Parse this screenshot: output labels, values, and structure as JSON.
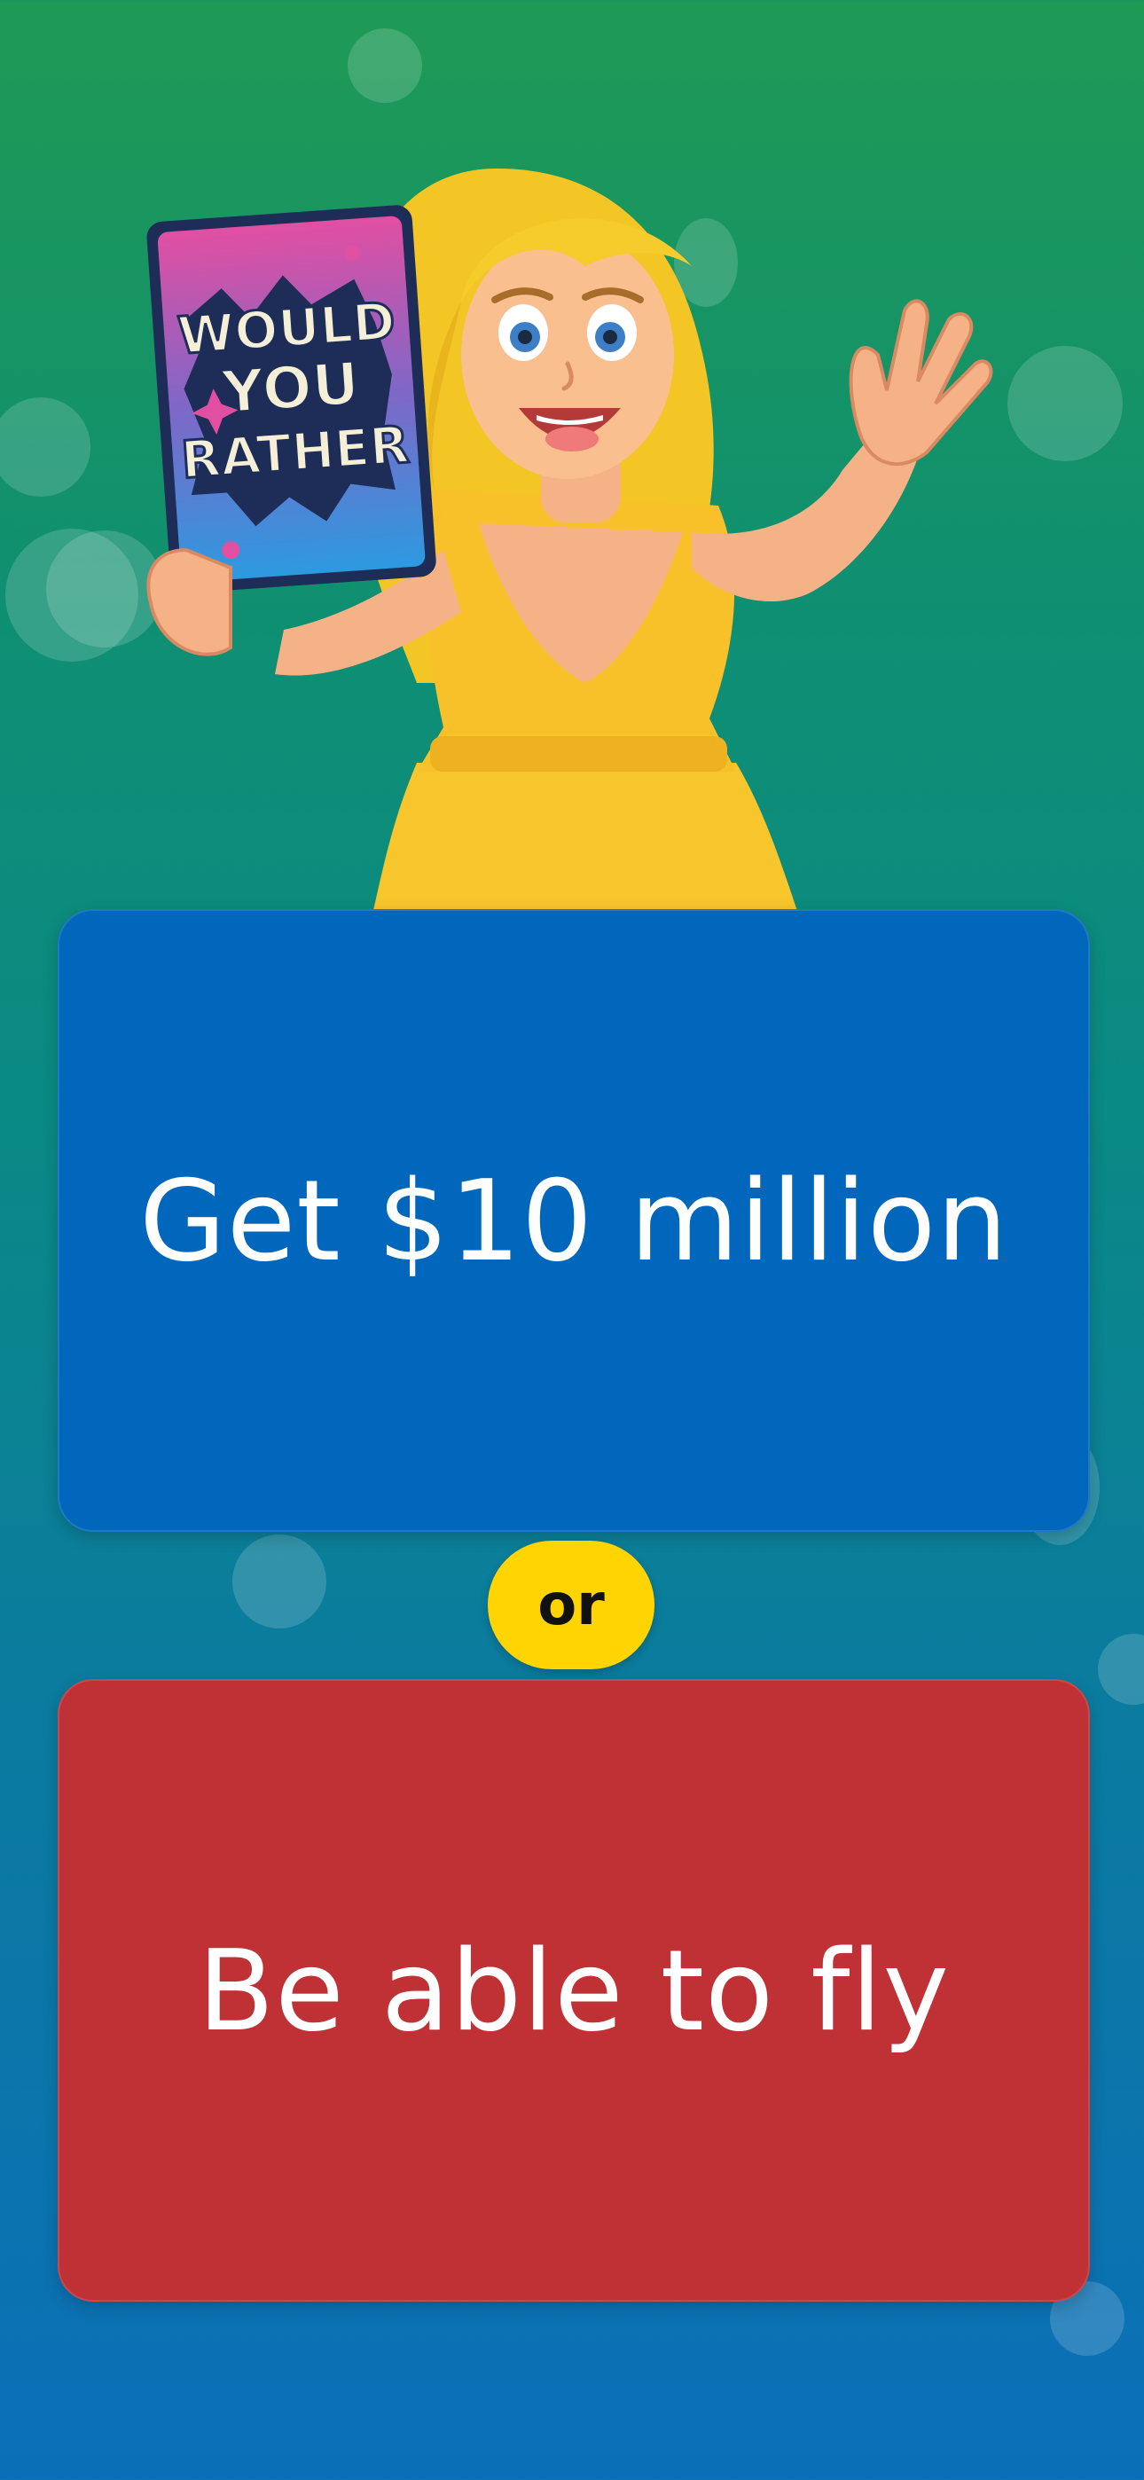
{
  "hero": {
    "sign_lines": [
      "WOULD",
      "YOU",
      "RATHER"
    ]
  },
  "options": {
    "first": "Get $10 million",
    "divider": "or",
    "second": "Be able to fly"
  },
  "colors": {
    "option_first_bg": "#0067bd",
    "option_second_bg": "#bf3135",
    "divider_bg": "#ffd400"
  }
}
